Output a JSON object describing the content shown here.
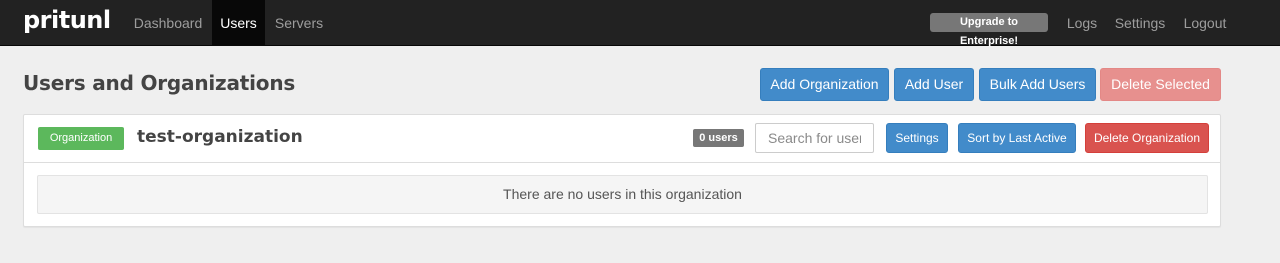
{
  "navbar": {
    "brand": "pritunl",
    "left_links": [
      {
        "label": "Dashboard",
        "active": false
      },
      {
        "label": "Users",
        "active": true
      },
      {
        "label": "Servers",
        "active": false
      }
    ],
    "upgrade_label": "Upgrade to Enterprise!",
    "right_links": [
      {
        "label": "Logs"
      },
      {
        "label": "Settings"
      },
      {
        "label": "Logout"
      }
    ]
  },
  "header": {
    "title": "Users and Organizations",
    "buttons": {
      "add_organization": "Add Organization",
      "add_user": "Add User",
      "bulk_add_users": "Bulk Add Users",
      "delete_selected": "Delete Selected"
    }
  },
  "organization": {
    "label": "Organization",
    "name": "test-organization",
    "user_count": "0 users",
    "search_placeholder": "Search for user",
    "buttons": {
      "settings": "Settings",
      "sort": "Sort by Last Active",
      "delete": "Delete Organization"
    },
    "empty_message": "There are no users in this organization"
  },
  "colors": {
    "navbar_bg": "#222222",
    "primary": "#428bca",
    "danger": "#d9534f",
    "danger_disabled": "#e7908e",
    "success": "#5cb85c",
    "badge": "#777777"
  }
}
